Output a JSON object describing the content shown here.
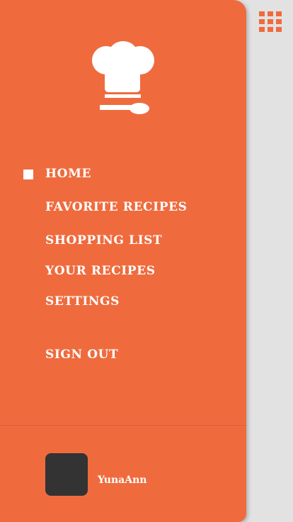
{
  "nav": {
    "items": [
      {
        "label": "HOME"
      },
      {
        "label": "FAVORITE RECIPES"
      },
      {
        "label": "SHOPPING LIST"
      },
      {
        "label": "YOUR RECIPES"
      },
      {
        "label": "SETTINGS"
      },
      {
        "label": "SIGN OUT"
      }
    ],
    "active_index": 0
  },
  "user": {
    "name": "YunaAnn"
  },
  "icons": {
    "logo": "chef-hat-spoon-icon",
    "menu": "grid-menu-icon",
    "active": "square-bullet-icon"
  },
  "colors": {
    "accent": "#ef6b3e",
    "background": "#e2e2e2",
    "avatar": "#333333",
    "text": "#ffffff"
  }
}
